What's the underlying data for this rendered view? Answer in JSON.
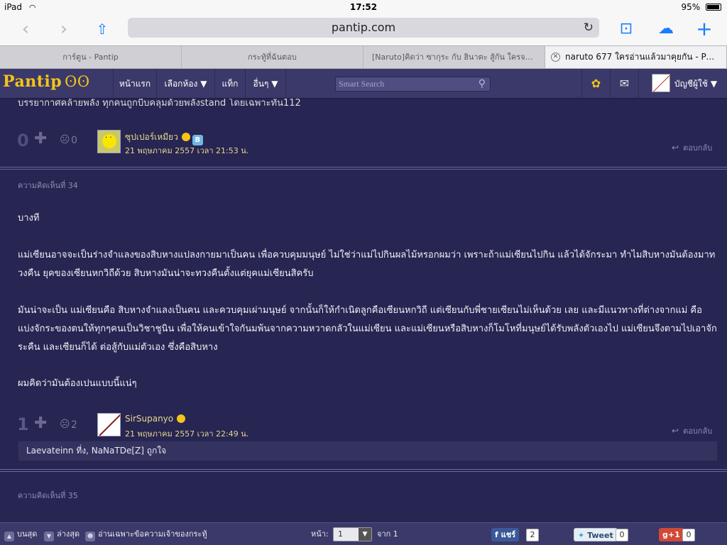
{
  "status_bar": {
    "device": "iPad",
    "time": "17:52",
    "battery": "95%"
  },
  "browser": {
    "url": "pantip.com",
    "tabs": [
      {
        "title": "การ์ตูน - Pantip"
      },
      {
        "title": "กระทู้ที่ฉันตอบ"
      },
      {
        "title": "[Naruto]คิดว่า ซากุระ กับ ฮินาตะ สู้กัน ใครจะชนะ..."
      },
      {
        "title": "naruto 677 ใครอ่านแล้วมาคุยกัน - Pantip"
      }
    ]
  },
  "navbar": {
    "logo": "Pantip",
    "logo_mark": "ʘʘ",
    "home": "หน้าแรก",
    "rooms": "เลือกห้อง ▼",
    "tags": "แท็ก",
    "more": "อื่นๆ ▼",
    "search_placeholder": "Smart Search",
    "account": "บัญชีผู้ใช้ ▼"
  },
  "cut_text": "บรรยากาศคล้ายพลัง ทุกคนถูกบีบคลุมด้วยพลังstand  โดยเฉพาะทัน112",
  "reply1": {
    "votes": "0",
    "emotions": "0",
    "username": "ซุปเปอร์เหมียว",
    "date": "21 พฤษภาคม 2557 เวลา 21:53 น.",
    "reply_label": "ตอบกลับ"
  },
  "comment34": {
    "label": "ความคิดเห็นที่ 34",
    "paragraphs": [
      "บางที",
      "แม่เซียนอาจจะเป็นร่างจำแลงของสิบหางแปลงกายมาเป็นคน เพื่อควบคุมมนุษย์ ไม่ใช่ว่าแม่ไปกินผลไม้หรอกผมว่า เพราะถ้าแม่เซียนไปกิน แล้วได้จักระมา ทำไมสิบหางมันต้องมาทวงคืน ยุคของเซียนหกวิถีด้วย สิบหางมันน่าจะทวงคืนตั้งแต่ยุคแม่เซียนสิครับ",
      "มันน่าจะเป็น แม่เซียนคือ สิบหางจำแลงเป็นคน และควบคุมเผ่ามนุษย์ จากนั้นก็ให้กำเนิดลูกคือเซียนหกวิถี แต่เซียนกับพี่ชายเซียนไม่เห็นด้วย เลย และมีแนวทางที่ต่างจากแม่ คือ แบ่งจักระของตนให้ทุกๆคนเป็นวิชาชูนิน เพื่อให้คนเข้าใจกันมพ้นจากความหวาดกลัวในแม่เซียน และแม่เซียนหรือสิบหางก็โมโหที่มนุษย์ได้รับพลังตัวเองไป แม่เซียนจึงตามไปเอาจักระคืน และเซียนก็ได้ ต่อสู้กับแม่ตัวเอง ซึ่งคือสิบหาง",
      "ผมคิดว่ามันต้องเปนแบบนี้แน่ๆ"
    ],
    "votes": "1",
    "emotions": "2",
    "username": "SirSupanyo",
    "date": "21 พฤษภาคม 2557 เวลา 22:49 น.",
    "reply_label": "ตอบกลับ",
    "sub_reply": "Laevateinn ที่ง, NaNaTDe[Z] ถูกใจ"
  },
  "comment35": {
    "label": "ความคิดเห็นที่ 35"
  },
  "bottom_bar": {
    "top": "บนสุด",
    "bottom": "ล่างสุด",
    "owner_only": "อ่านเฉพาะข้อความเจ้าของกระทู้",
    "page_label": "หน้า:",
    "page_value": "1",
    "page_of": "จาก 1",
    "fb_share": "แชร์",
    "fb_count": "2",
    "tweet": "Tweet",
    "tweet_count": "0",
    "gplus": "+1",
    "gplus_count": "0"
  },
  "colors": {
    "page_bg": "#272552",
    "navbar_bg": "#3b3969",
    "logo": "#f4c419",
    "username": "#e6d78f",
    "ios_blue": "#1a7cff"
  }
}
